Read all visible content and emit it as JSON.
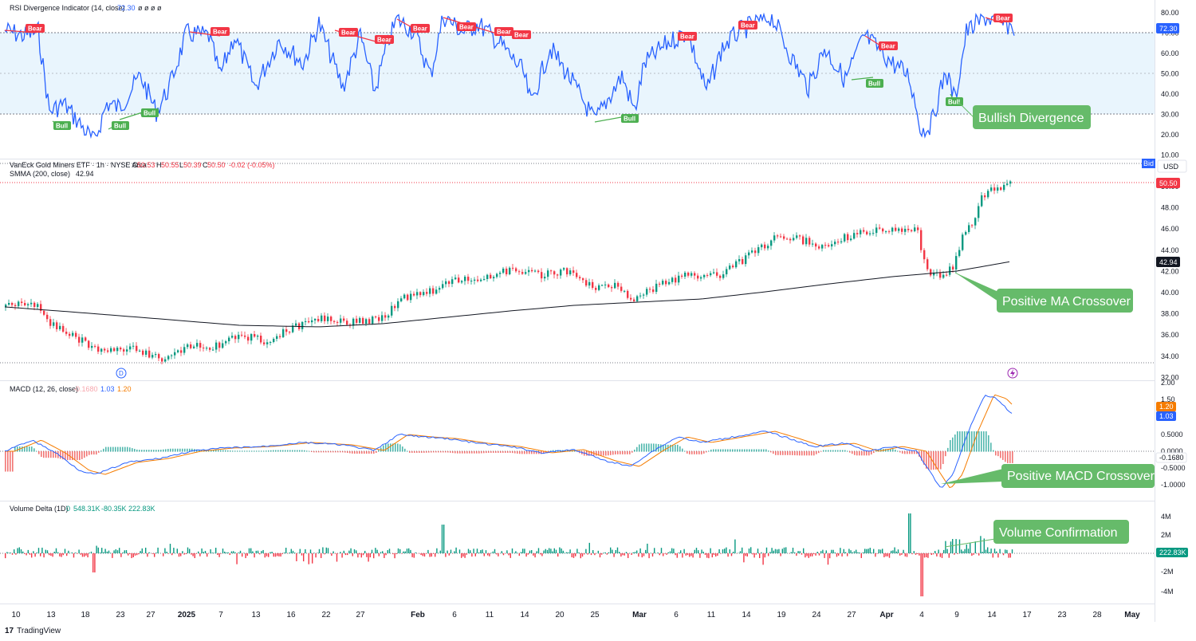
{
  "rsi": {
    "title": "RSI Divergence Indicator (14, close)",
    "value": "72.30",
    "flags": "ø ø ø ø",
    "ticks": [
      "80.00",
      "70.00",
      "60.00",
      "50.00",
      "40.00",
      "30.00",
      "20.00",
      "10.00"
    ],
    "last_tag": "72.30",
    "bear_label": "Bear",
    "bull_label": "Bull",
    "annotation": "Bullish Divergence"
  },
  "price": {
    "title": "VanEck Gold Miners ETF · 1h · NYSE Arca",
    "ohlc": {
      "o_label": "O",
      "o": "50.53",
      "h_label": "H",
      "h": "50.55",
      "l_label": "L",
      "l": "50.39",
      "c_label": "C",
      "c": "50.50",
      "chg": "-0.02 (-0.05%)"
    },
    "smma_label": "SMMA (200, close)",
    "smma_value": "42.94",
    "ticks": [
      "50.00",
      "48.00",
      "46.00",
      "44.00",
      "42.00",
      "40.00",
      "38.00",
      "36.00",
      "34.00",
      "32.00"
    ],
    "last_tag": "50.50",
    "smma_tag": "42.94",
    "bid_label": "Bid",
    "currency": "USD",
    "annotation": "Positive MA Crossover",
    "dividend_marker": "D"
  },
  "macd": {
    "title": "MACD (12, 26, close)",
    "v1": "-0.1680",
    "v2": "1.03",
    "v3": "1.20",
    "ticks": [
      "2.00",
      "1.50",
      "1.00",
      "0.5000",
      "0.0000",
      "-0.5000",
      "-1.0000"
    ],
    "tag_orange": "1.20",
    "tag_blue": "1.03",
    "tag_hist": "-0.1680",
    "annotation": "Positive MACD Crossover"
  },
  "volume": {
    "title": "Volume Delta (1D)",
    "v0": "0",
    "v1": "548.31K",
    "v2": "-80.35K",
    "v3": "222.83K",
    "ticks": [
      "4M",
      "2M",
      "0",
      "-2M",
      "-4M"
    ],
    "last_tag": "222.83K",
    "annotation": "Volume Confirmation"
  },
  "x_axis": [
    "10",
    "13",
    "18",
    "23",
    "27",
    "2025",
    "7",
    "13",
    "16",
    "22",
    "27",
    "Feb",
    "6",
    "11",
    "14",
    "20",
    "25",
    "Mar",
    "6",
    "11",
    "14",
    "19",
    "24",
    "27",
    "Apr",
    "4",
    "9",
    "14",
    "17",
    "23",
    "28",
    "May"
  ],
  "branding": "TradingView",
  "colors": {
    "up": "#089981",
    "down": "#f23645",
    "rsi_line": "#2962ff",
    "smma": "#131722",
    "macd_line": "#2962ff",
    "signal_line": "#f57c00",
    "callout": "#66bb6a",
    "rsi_band": "#e3f2fd"
  }
}
